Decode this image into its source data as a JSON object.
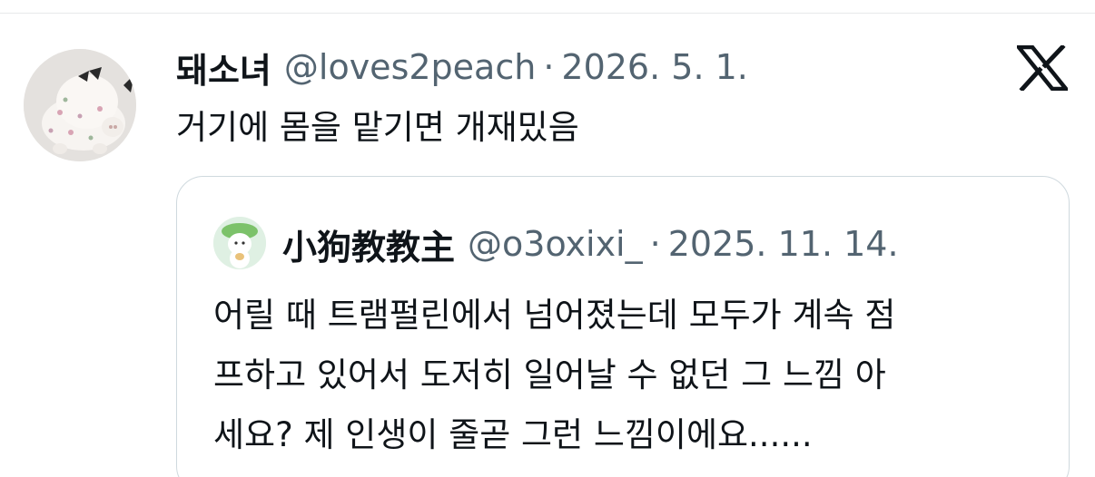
{
  "tweet": {
    "author_name": "돼소녀",
    "handle": "@loves2peach",
    "separator": "·",
    "date": "2026. 5. 1.",
    "text": "거기에 몸을 맡기면 개재밌음",
    "platform_icon": "x-logo-icon"
  },
  "quoted_tweet": {
    "author_name": "小狗教教主",
    "handle": "@o3oxixi_",
    "separator": "·",
    "date": "2025. 11. 14.",
    "text_lines": [
      "어릴 때 트램펄린에서 넘어졌는데 모두가 계속 점",
      "프하고 있어서 도저히 일어날 수 없던 그 느낌 아",
      "세요? 제 인생이 줄곧 그런 느낌이에요......"
    ]
  },
  "colors": {
    "text_primary": "#0f1419",
    "text_secondary": "#536471",
    "border": "#cfd9de"
  }
}
